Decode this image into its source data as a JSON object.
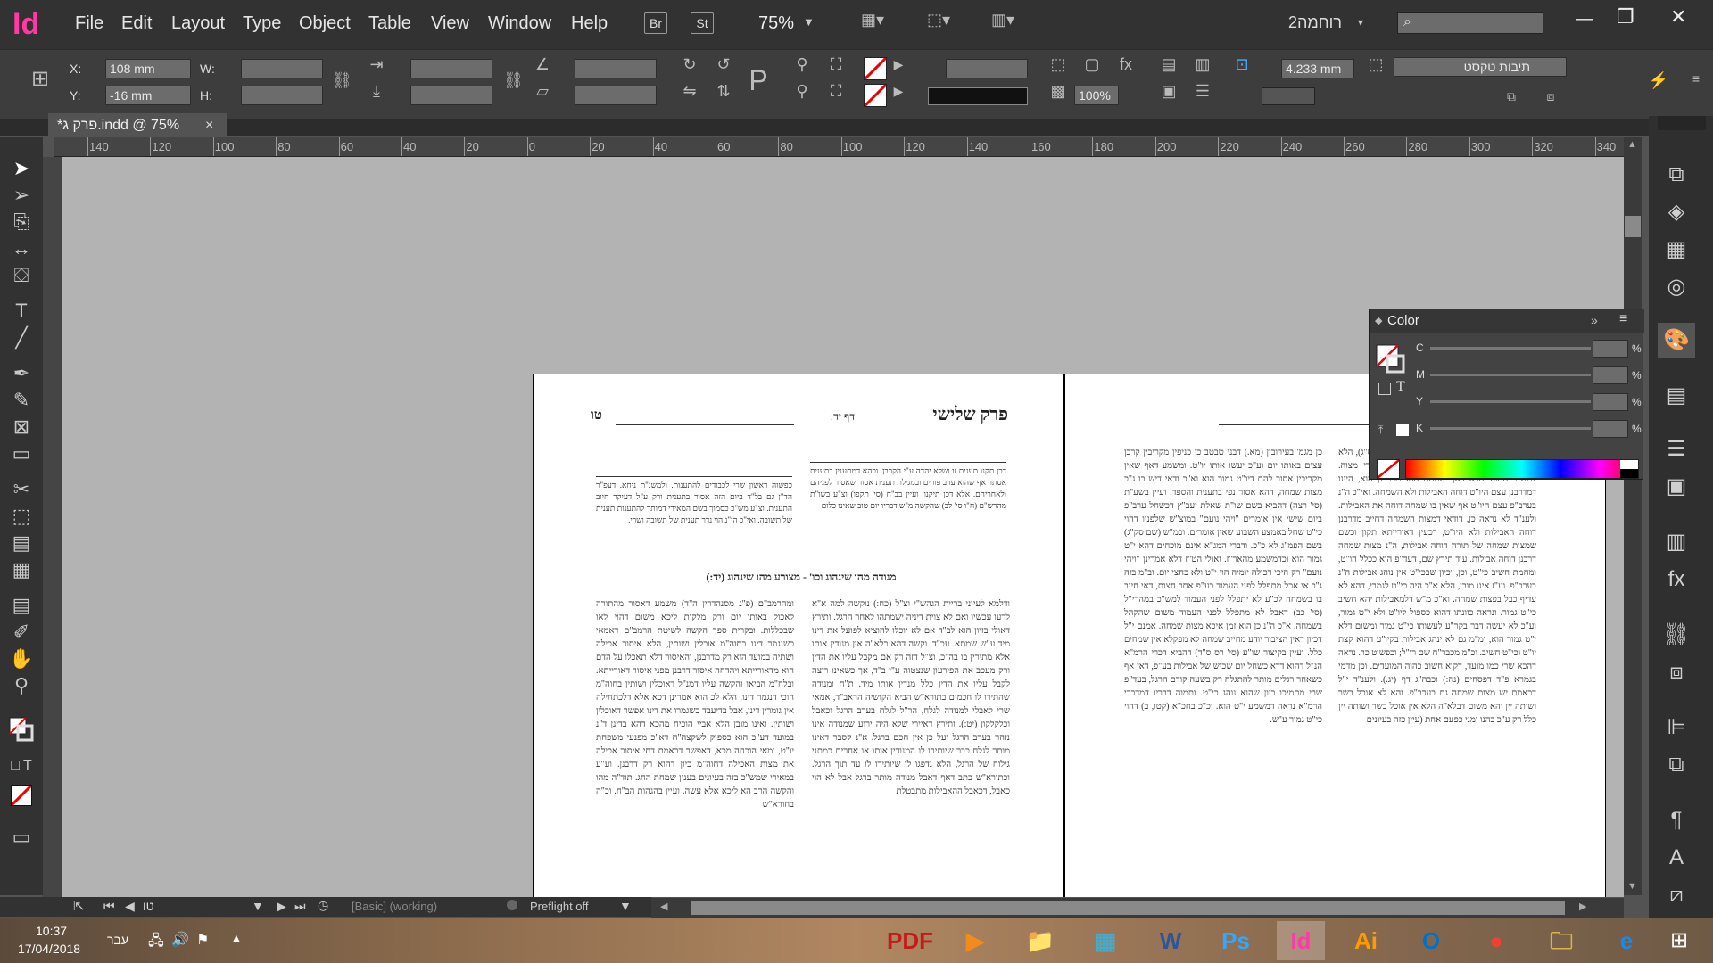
{
  "app": {
    "logo": "Id",
    "menus": [
      "File",
      "Edit",
      "Layout",
      "Type",
      "Object",
      "Table",
      "View",
      "Window",
      "Help"
    ],
    "bridge_btn": "Br",
    "stock_btn": "St",
    "zoom": "75%",
    "workspace": "רוחמה2",
    "window_controls": [
      "—",
      "❐",
      "✕"
    ]
  },
  "control": {
    "x_label": "X:",
    "x_value": "108 mm",
    "y_label": "Y:",
    "y_value": "-16 mm",
    "w_label": "W:",
    "h_label": "H:",
    "opacity": "100%",
    "stroke_weight": "4.233 mm",
    "style_name": "תיבות טקסט"
  },
  "doc_tab": {
    "title": "*פרק ג.indd @ 75%",
    "close": "×"
  },
  "ruler_ticks": [
    "140",
    "120",
    "100",
    "80",
    "60",
    "40",
    "20",
    "0",
    "20",
    "40",
    "60",
    "80",
    "100",
    "120",
    "140",
    "160",
    "180",
    "200",
    "220",
    "240",
    "260",
    "280",
    "300",
    "320",
    "340"
  ],
  "page": {
    "header_title": "פרק שלישי",
    "header_sub": "דף יד:",
    "page_number": "טו",
    "section_heading": "מנודה מהו שינהוג וכו' - מצורע מהו שינהוג (יד:)",
    "bold_terms": [
      "ודלמא",
      "ומהרמב\"ם",
      "ת\"ח",
      "תוד\"ה",
      "ועיין",
      "וב\"מ",
      "עוד",
      "ולענ\"ד"
    ],
    "col_top_right": "דכן תקנו תענית זו ושלא יהדה ע\"י הקרבן. וכהא דמתענין בתענית אסתר אף שהוא ערב פורים ובמגילת תענית אסור שאסור לפניהם ולאחריהם. אלא דכן תיקנו. ועיין בב\"ח (סי' תקפו) וצ\"ע בשו\"ת מהרש\"ם (ח\"ו סי' לב) שהקשה מ\"ש דבריו יום טוב שאינו כלום",
    "col_top_left": "כפשוה ראשון שרי לכבודים להתענות. ולמשנ\"ת ניחא. דעפ\"ר הד\"ן גם בל\"ד ביום הזה אסור בתענית ורק ע\"ל דעיקר חיוב התענית. וצ\"ע מש\"כ כסמוך בשם המאירי דמותר להתענות תענית של תשובה. ואי\"כ הי\"נ הוי נדר תענית של תשובה ושרי.",
    "col_a": "ודלמא לעיוני בריית הגהש\"י וצ\"ל (כח:) נוקשה למה א\"א לרעו עכשיו ואם לא צוית דיניה ישמתהו לאחר הרגל. ותירץ דאולי בזיון הוא לב\"ד אם לא יוכלו להוציא לפועל את דינו מיד ע\"ש שמתא. עכ\"ד. וקשה דהא כלא\"ה אין מנודין אותו אלא מתירין בו בה\"כ, וצ\"ל דזה רק אם מקבל עליו את הדין ורק מעכב את הפירעון שנצטוה ע\"י ב\"ד, אך כשאינו רוצה לקבל עליו את הדין כלל מנדין אותו מיד. ת\"ח ומנודה שהתירו לו חכמים בתורא\"ש הביא הקושיה הראב\"ד, אמאי שרי לאבלי למנודה לגלח, הר\"ל לגלח בערב הרגל וכאבל וכלקלקון (יט:). ותירץ דאיירי שלא היה ירוע שמנודה אינו נזהר בערב הרגל ועל כן אין חכם ברגל. א\"נ קסבר דאינו מותר לגלח כבר שיותירו לו המנודין אותו או אחרים כמתני גילוח של הרגל, הלא נדפגו לו שיותירו לו עד תוך הרגל. וכתורא\"ש כתב דאף דאבל מנודה מותר ברגל אבל לא הוי כאבל, דכאבל ההאבילות מתבטלת",
    "col_b": "ומהרמב\"ם (פ\"ג מסנהדרין ה\"ד) משמע דאסור מהתורה לאכול באותו יום ורק מלקות ליכא משום דהוי לאו שבכללות. ובקרית ספר הקשה לשיטת הרמב\"ם דאמאי כשנגמר דינו בחוה\"מ אוכלין ושותין, הלא איסור אכילה ושתיה במועד הוא רק מדרבנן, והאיסור דלא תאכלו על הדם הוא מדאורייתא ויהדחה איסור דרבנן מפני איסור דאורייתא. ובלח\"מ הביאו והקשה עליו דמנ\"ל דאוכלין ושותין בחוה\"מ הוכי דנגמר דינו, הלא לכ הוא אמרינן דכא אלא דלכתחילה אין גומרין דינו, אבל בדיעבד כשגמרו את דינו אפשר דאוכלין ושותין. ואינו מובן הלא אביי הוכיח מהכא דהא בדינן ד\"נ במועד דע\"כ הוא כספוק לשקצה\"ח דא\"כ מפנעי משפחת יו\"ט, ומאי הוכחה מכא, דאפשר דבאמת דחי איסור אכילה את מצות האכילה דחוה\"מ כיון דהוא רק דרבנן. וע\"ע במאירי שמש\"כ בזה בעיונים בענין שמחת החג. תוד\"ה מהו והקשה הרב הא ליכא אלא עשה. ועיין בהגהות הב\"ח. וכ\"ה בחורא\"ש",
    "col_c": "כן מגמ' בעירובין (מא.) דבני טבטב כן כניפין מקריבין קרבן עצים באותו יום וע\"כ יעשו אותו יו\"ט. ומשמע דאף שאין מקריבין אסור להם דיו\"ט גמור הוא וא\"כ ודאי דיש בו ג\"כ מצות שמחה, דהא אסור נפי בתענית והספד. ועיין בשע\"ת (סי' רצה) דהביא בשם שו\"ת שאלת יעב\"ץ דכשחל ערב\"פ ביום שישי אין אומרים \"ויהי נועם\" במוצ\"ש שלפניו דהוי כי\"ט שחל באמצע השבוע שאין אומרים. וכמ\"ש (שם סק\"ג) בשם הפמ\"ג לא כ\"כ. ודברי המג\"א אינם מוכחים דהא י\"ט גמור הוא וכדמשמע מהאר\"ז. ואולי הט\"ז דלא אמרינן \"ויהי נועם\" רק היכי דכולה יומיה הוי י\"ט ולא כחצי יום. וב\"מ בזה ג\"כ אי אכל מתפלל לפני העמוד בע\"פ אחר חצות, דאי חייב בו בשמחה לכ\"ע לא יתפלל לפני העמוד למש\"כ במהרי\"ל (סי' כב) דאבל לא מתפלל לפני העמוד משום שהקהל בשמחה. א\"כ ה\"נ כן הוא זמן איכא מצות שמחה. אמנם י\"ל דכיון דאין הציבור יודע מחייב שמחה לא מפקלא אין שמחים כלל. ועיין בקיצור שו\"ע (סי' רס ס\"ד) דהביא דכרי הרמ\"א הנ\"ל דהוא דדא כשחל יום שכיש של אבילות בע\"פ, דאז אף כשאחר רגלים מותר להתגלח רק בשעה קודם הרגל, בעד\"פ שרי מתמיכו כיון שהוא נוהג כי\"ט. ותמוה דבריו דמדברי הרמ\"א נראה דמשמע י\"ט הוא. וכ\"כ בחכ\"א (קטו, ב) דהוי כי\"ט גמור ע\"ש.",
    "col_d": "אין נוהג בו אבילות וכש\"כ הרמ\"א (יו\"ד סי' שצט ס\"ג), הלא ליכא דין שמחה וחידוש הגהות השבט ובמאירי מצוה. למש\"כ החוס' הכא דאף שמחת החג מדרבנן הוא, היינו דמדרבנן עצם היו\"ט דוחה האבילות ולא השמחה. ואי\"כ ה\"נ בערב\"פ עצם היו\"ט אף שאין בו שמחה דוחה את האבילות. ולענ\"ד לא נראה כן, דודאי דמצות השמחה דחייב מדרבנן דוחה האבילות ולא היו\"ט, דכעין דאורייתא תקון וכשם שמצות שמחה של תורה דוחה אבילות, ה\"נ מצות שמחה דרבנן דוחה אבילות. עוד תירץ שם, דעד\"פ הוא ככלל הו\"ט, ומחמת חשיב כי\"ט, וכן, וכיון שבכי\"ט אין נוהג אבילות ה\"נ בערב\"פ. וע\"ז אינו מובן, הלא א\"כ היה כי\"ט לגמרי, דהא לא עדיף כבל בפצות שמחה. וא\"כ מ\"ש דלמאבילות יהא חשיב כי\"ט גמור. ונראה כוונתו דהוא כספול ליו\"ט ולא י\"ט גמור, וע\"כ לא יעשה דבר בקר\"ע לעשותו כי\"ט גמור ומשום דלא י\"ט גמור הוא, ומ\"מ גם לא ינהג אבילות בקיו\"ע דהוא קצת יו\"ט וכי\"ט חשיב. וכ\"מ מכבר\"ח שם רו\"ל; וכפשוט כר. נראה דהכא שרי כמו מועד, דקוא חשוב כהוה המועדים. וכן מדמי בגמרא פ\"ד דפסחים (נה:) וכבה\"ג דף (יג.). ולענ\"ד י\"ל דכאמת יש מצות שמחה גם בערב\"פ. והא לא אוכל בשר ושותה יין והא משום דבלא\"ה הלא אין אוכל בשר ושותה יין כלל רק ע\"כ בהנו ומני כפעם אחת (עיין כזה בעיונים"
  },
  "color_panel": {
    "title": "Color",
    "channels": [
      "C",
      "M",
      "Y",
      "K"
    ],
    "percent": "%",
    "menu": "≡"
  },
  "status": {
    "page_field": "טו",
    "style_info": "[Basic] (working)",
    "preflight": "Preflight off"
  },
  "taskbar": {
    "time": "10:37",
    "date": "17/04/2018",
    "lang": "עבר",
    "apps": [
      "PDF",
      "▶",
      "📁",
      "▦",
      "W",
      "Ps",
      "Id",
      "Ai",
      "O",
      "●",
      "🗀",
      "e"
    ],
    "app_colors": [
      "#c41a1a",
      "#f08c1e",
      "#e6c229",
      "#4aa8c8",
      "#2b579a",
      "#31a8ff",
      "#ff3aa5",
      "#ff9a00",
      "#0072c6",
      "#ea4335",
      "#d9b44a",
      "#1e88e5"
    ]
  }
}
